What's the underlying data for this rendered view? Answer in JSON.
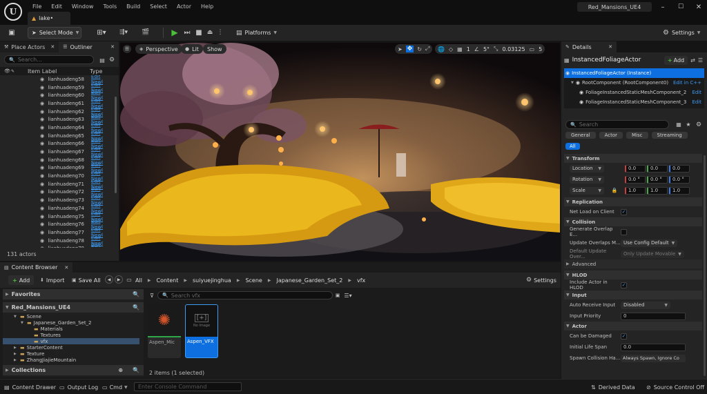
{
  "titlebar": {
    "menu": [
      "File",
      "Edit",
      "Window",
      "Tools",
      "Build",
      "Select",
      "Actor",
      "Help"
    ],
    "project_name": "Red_Mansions_UE4",
    "level_tab": "lake•"
  },
  "toolbar": {
    "select_mode": "Select Mode",
    "platforms": "Platforms",
    "settings": "Settings"
  },
  "left_panel": {
    "tab_place_actors": "Place Actors",
    "tab_outliner": "Outliner",
    "search_placeholder": "Search...",
    "col_item_label": "Item Label",
    "col_type": "Type",
    "rows": [
      {
        "label": "lianhuadeng58",
        "type": "Edit Newl"
      },
      {
        "label": "lianhuadeng59",
        "type": "Edit Newl"
      },
      {
        "label": "lianhuadeng60",
        "type": "Edit Newl"
      },
      {
        "label": "lianhuadeng61",
        "type": "Edit Newl"
      },
      {
        "label": "lianhuadeng62",
        "type": "Edit Newl"
      },
      {
        "label": "lianhuadeng63",
        "type": "Edit Newl"
      },
      {
        "label": "lianhuadeng64",
        "type": "Edit Newl"
      },
      {
        "label": "lianhuadeng65",
        "type": "Edit Newl"
      },
      {
        "label": "lianhuadeng66",
        "type": "Edit Newl"
      },
      {
        "label": "lianhuadeng67",
        "type": "Edit Newl"
      },
      {
        "label": "lianhuadeng68",
        "type": "Edit Newl"
      },
      {
        "label": "lianhuadeng69",
        "type": "Edit Newl"
      },
      {
        "label": "lianhuadeng70",
        "type": "Edit Newl"
      },
      {
        "label": "lianhuadeng71",
        "type": "Edit Newl"
      },
      {
        "label": "lianhuadeng72",
        "type": "Edit Newl"
      },
      {
        "label": "lianhuadeng73",
        "type": "Edit Newl"
      },
      {
        "label": "lianhuadeng74",
        "type": "Edit Newl"
      },
      {
        "label": "lianhuadeng75",
        "type": "Edit Newl"
      },
      {
        "label": "lianhuadeng76",
        "type": "Edit Newl"
      },
      {
        "label": "lianhuadeng77",
        "type": "Edit Newl"
      },
      {
        "label": "lianhuadeng78",
        "type": "Edit Newl"
      },
      {
        "label": "lianhuadeng79",
        "type": "Edit Newl"
      },
      {
        "label": "lianhuadeng80",
        "type": "Edit Newl"
      }
    ],
    "actor_count": "131 actors"
  },
  "viewport": {
    "perspective": "Perspective",
    "lit": "Lit",
    "show": "Show",
    "grid_size": "1",
    "rot_snap": "5°",
    "scale_snap": "0.03125",
    "camera_speed": "5"
  },
  "content_browser": {
    "tab": "Content Browser",
    "add": "Add",
    "import": "Import",
    "save_all": "Save All",
    "breadcrumb": [
      "All",
      "Content",
      "suiyuejinghua",
      "Scene",
      "Japanese_Garden_Set_2",
      "vfx"
    ],
    "settings": "Settings",
    "favorites": "Favorites",
    "project_root": "Red_Mansions_UE4",
    "tree": [
      {
        "label": "Scene",
        "indent": 1
      },
      {
        "label": "Japanese_Garden_Set_2",
        "indent": 2
      },
      {
        "label": "Materials",
        "indent": 3
      },
      {
        "label": "Textures",
        "indent": 3
      },
      {
        "label": "vfx",
        "indent": 3
      },
      {
        "label": "StarterContent",
        "indent": 1
      },
      {
        "label": "Texture",
        "indent": 1
      },
      {
        "label": "ZhangJiajieMountain",
        "indent": 1
      }
    ],
    "collections": "Collections",
    "search_placeholder": "Search vfx",
    "assets": [
      {
        "name": "Aspen_Mic",
        "thumb": "preview"
      },
      {
        "name": "Aspen_VFX",
        "thumb": "No Image"
      }
    ],
    "status": "2 items (1 selected)"
  },
  "details": {
    "tab": "Details",
    "actor_name": "InstancedFoliageActor",
    "add": "Add",
    "components": [
      {
        "label": "InstancedFoliageActor (Instance)",
        "link": ""
      },
      {
        "label": "RootComponent (RootComponent0)",
        "link": "Edit in C++"
      },
      {
        "label": "FoliageInstancedStaticMeshComponent_2",
        "link": "Edit"
      },
      {
        "label": "FoliageInstancedStaticMeshComponent_3",
        "link": "Edit"
      }
    ],
    "search_placeholder": "Search",
    "filter_tabs": [
      "General",
      "Actor",
      "Misc",
      "Streaming"
    ],
    "filter_all": "All",
    "sections": {
      "transform": "Transform",
      "location": {
        "label": "Location",
        "x": "0.0",
        "y": "0.0",
        "z": "0.0"
      },
      "rotation": {
        "label": "Rotation",
        "x": "0.0 °",
        "y": "0.0 °",
        "z": "0.0 °"
      },
      "scale": {
        "label": "Scale",
        "x": "1.0",
        "y": "1.0",
        "z": "1.0"
      },
      "replication": "Replication",
      "net_load": "Net Load on Client",
      "collision": "Collision",
      "gen_overlap": "Generate Overlap E...",
      "update_overlaps": "Update Overlaps M...",
      "update_overlaps_value": "Use Config Default",
      "default_update": "Default Update Over...",
      "default_update_value": "Only Update Movable",
      "advanced": "Advanced",
      "hlod": "HLOD",
      "include_hlod": "Include Actor in HLOD",
      "input": "Input",
      "auto_receive": "Auto Receive Input",
      "auto_receive_value": "Disabled",
      "input_priority": "Input Priority",
      "input_priority_value": "0",
      "actor": "Actor",
      "can_be_damaged": "Can be Damaged",
      "initial_life": "Initial Life Span",
      "initial_life_value": "0.0",
      "spawn_collision": "Spawn Collision Ha...",
      "spawn_collision_value": "Always Spawn, Ignore Co"
    }
  },
  "statusbar": {
    "content_drawer": "Content Drawer",
    "output_log": "Output Log",
    "cmd": "Cmd",
    "console_placeholder": "Enter Console Command",
    "derived_data": "Derived Data",
    "source_control": "Source Control Off"
  },
  "colors": {
    "accent_blue": "#0e70e0",
    "link_blue": "#3e9cf5",
    "play_green": "#4cbf3a",
    "folder_yellow": "#c9a255"
  }
}
